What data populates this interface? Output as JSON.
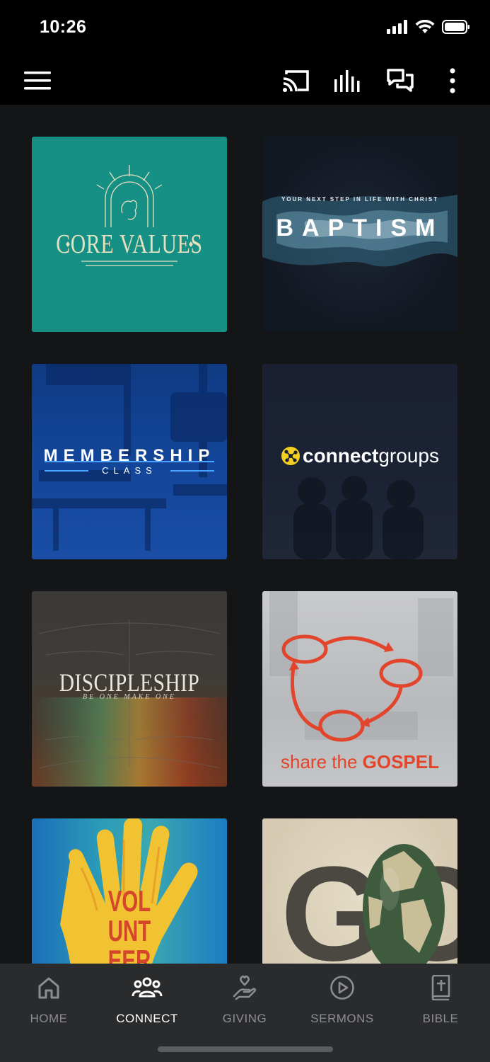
{
  "status_bar": {
    "time": "10:26"
  },
  "app_bar": {
    "icons": [
      "menu-icon",
      "cast-icon",
      "audio-bars-icon",
      "chat-icon",
      "more-vertical-icon"
    ]
  },
  "tiles": [
    {
      "title": "CORE VALUES"
    },
    {
      "subtitle": "YOUR NEXT STEP IN LIFE WITH CHRIST",
      "title": "BAPTISM"
    },
    {
      "title": "MEMBERSHIP",
      "subtitle": "CLASS"
    },
    {
      "title_bold": "connect",
      "title_light": "groups"
    },
    {
      "title": "DISCIPLESHIP",
      "subtitle": "BE ONE  MAKE ONE"
    },
    {
      "title_light": "share the ",
      "title_bold": "GOSPEL"
    },
    {
      "title_lines": [
        "VOL",
        "UNT",
        "EER"
      ]
    },
    {
      "title": "GO"
    }
  ],
  "bottom_nav": {
    "active": "connect",
    "items": [
      {
        "id": "home",
        "label": "HOME",
        "icon": "home-icon"
      },
      {
        "id": "connect",
        "label": "CONNECT",
        "icon": "people-group-icon"
      },
      {
        "id": "giving",
        "label": "GIVING",
        "icon": "giving-hand-icon"
      },
      {
        "id": "sermons",
        "label": "SERMONS",
        "icon": "play-circle-icon"
      },
      {
        "id": "bible",
        "label": "BIBLE",
        "icon": "bible-icon"
      }
    ]
  },
  "colors": {
    "background": "#141517",
    "bar": "#000000",
    "nav_bg": "#2a2b2d",
    "nav_inactive": "#8c8d90",
    "nav_active": "#ffffff",
    "core_values_teal": "#168f85",
    "membership_blue": "#124497",
    "gospel_orange": "#e2452b",
    "connect_yellow": "#f5d020"
  }
}
